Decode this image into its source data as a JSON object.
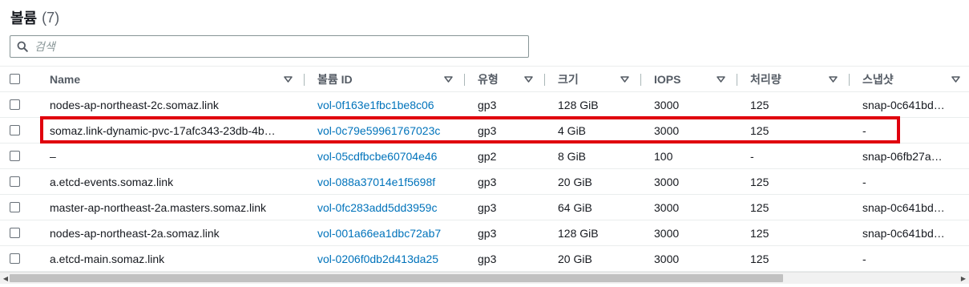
{
  "header": {
    "title": "볼륨",
    "count": "(7)"
  },
  "search": {
    "placeholder": "검색",
    "value": ""
  },
  "columns": [
    {
      "label": "Name"
    },
    {
      "label": "볼륨 ID"
    },
    {
      "label": "유형"
    },
    {
      "label": "크기"
    },
    {
      "label": "IOPS"
    },
    {
      "label": "처리량"
    },
    {
      "label": "스냅샷"
    }
  ],
  "rows": [
    {
      "name": "nodes-ap-northeast-2c.somaz.link",
      "volume_id": "vol-0f163e1fbc1be8c06",
      "type": "gp3",
      "size": "128 GiB",
      "iops": "3000",
      "throughput": "125",
      "snapshot": "snap-0c641bd…"
    },
    {
      "name": "somaz.link-dynamic-pvc-17afc343-23db-4b…",
      "volume_id": "vol-0c79e59961767023c",
      "type": "gp3",
      "size": "4 GiB",
      "iops": "3000",
      "throughput": "125",
      "snapshot": "-"
    },
    {
      "name": "–",
      "volume_id": "vol-05cdfbcbe60704e46",
      "type": "gp2",
      "size": "8 GiB",
      "iops": "100",
      "throughput": "-",
      "snapshot": "snap-06fb27a…"
    },
    {
      "name": "a.etcd-events.somaz.link",
      "volume_id": "vol-088a37014e1f5698f",
      "type": "gp3",
      "size": "20 GiB",
      "iops": "3000",
      "throughput": "125",
      "snapshot": "-"
    },
    {
      "name": "master-ap-northeast-2a.masters.somaz.link",
      "volume_id": "vol-0fc283add5dd3959c",
      "type": "gp3",
      "size": "64 GiB",
      "iops": "3000",
      "throughput": "125",
      "snapshot": "snap-0c641bd…"
    },
    {
      "name": "nodes-ap-northeast-2a.somaz.link",
      "volume_id": "vol-001a66ea1dbc72ab7",
      "type": "gp3",
      "size": "128 GiB",
      "iops": "3000",
      "throughput": "125",
      "snapshot": "snap-0c641bd…"
    },
    {
      "name": "a.etcd-main.somaz.link",
      "volume_id": "vol-0206f0db2d413da25",
      "type": "gp3",
      "size": "20 GiB",
      "iops": "3000",
      "throughput": "125",
      "snapshot": "-"
    }
  ],
  "highlighted_row": 1,
  "colors": {
    "link": "#0073bb",
    "highlight": "#e0000d",
    "text": "#16191f",
    "header_text": "#545b64"
  },
  "icons": {
    "search": "search-icon",
    "sort": "sort-caret-down-icon",
    "scroll_left": "scroll-left-arrow-icon",
    "scroll_right": "scroll-right-arrow-icon"
  }
}
